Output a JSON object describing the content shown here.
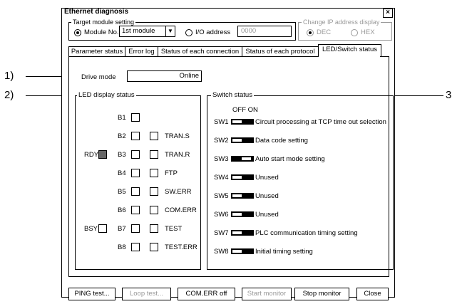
{
  "window": {
    "title": "Ethernet diagnosis",
    "close_glyph": "×"
  },
  "target": {
    "group_label": "Target module setting",
    "module_no_label": "Module No.",
    "module_value": "1st module",
    "io_address_label": "I/O address",
    "io_address_value": "0000"
  },
  "change_ip": {
    "group_label": "Change IP address display",
    "dec_label": "DEC",
    "hex_label": "HEX"
  },
  "tabs": [
    {
      "label": "Parameter status"
    },
    {
      "label": "Error log"
    },
    {
      "label": "Status of each connection"
    },
    {
      "label": "Status of each protocol"
    },
    {
      "label": "LED/Switch status",
      "active": true
    }
  ],
  "drive_mode": {
    "label": "Drive mode",
    "value": "Online"
  },
  "led": {
    "group_label": "LED display status",
    "rdy_label": "RDY",
    "bsy_label": "BSY",
    "rows": [
      {
        "name": "B1",
        "label": "",
        "has_second": false
      },
      {
        "name": "B2",
        "label": "TRAN.S",
        "has_second": true
      },
      {
        "name": "B3",
        "label": "TRAN.R",
        "has_second": true
      },
      {
        "name": "B4",
        "label": "FTP",
        "has_second": true
      },
      {
        "name": "B5",
        "label": "SW.ERR",
        "has_second": true
      },
      {
        "name": "B6",
        "label": "COM.ERR",
        "has_second": true
      },
      {
        "name": "B7",
        "label": "TEST",
        "has_second": true
      },
      {
        "name": "B8",
        "label": "TEST.ERR",
        "has_second": true
      }
    ]
  },
  "switch": {
    "group_label": "Switch status",
    "off_on_label": "OFF ON",
    "rows": [
      {
        "name": "SW1",
        "desc": "Circuit processing at TCP time out selection"
      },
      {
        "name": "SW2",
        "desc": "Data code setting"
      },
      {
        "name": "SW3",
        "desc": "Auto start mode setting"
      },
      {
        "name": "SW4",
        "desc": "Unused"
      },
      {
        "name": "SW5",
        "desc": "Unused"
      },
      {
        "name": "SW6",
        "desc": "Unused"
      },
      {
        "name": "SW7",
        "desc": "PLC communication timing setting"
      },
      {
        "name": "SW8",
        "desc": "Initial timing setting"
      }
    ]
  },
  "buttons": {
    "ping": "PING test...",
    "loop": "Loop test...",
    "comerr": "COM.ERR off",
    "start": "Start monitor",
    "stop": "Stop monitor",
    "close": "Close"
  },
  "callouts": {
    "c1": "1)",
    "c2": "2)",
    "c3": "3"
  }
}
